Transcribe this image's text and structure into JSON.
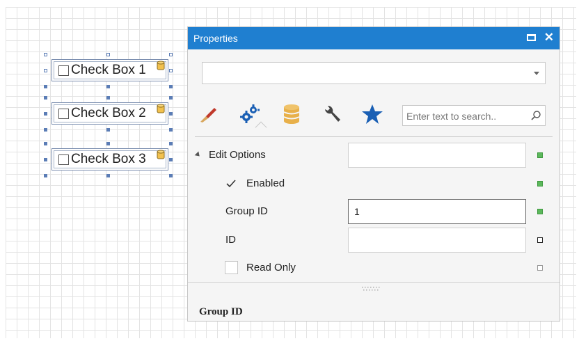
{
  "report_controls": [
    {
      "label": "Check Box 1"
    },
    {
      "label": "Check Box 2"
    },
    {
      "label": "Check Box 3"
    }
  ],
  "properties_panel": {
    "title": "Properties",
    "title_icons": [
      "maximize-icon",
      "close-icon"
    ],
    "combo_value": "",
    "tabs": [
      {
        "name": "appearance-tab",
        "icon": "brush-icon"
      },
      {
        "name": "behavior-tab",
        "icon": "gears-icon",
        "active": true
      },
      {
        "name": "data-tab",
        "icon": "database-icon"
      },
      {
        "name": "layout-tab",
        "icon": "wrench-icon"
      },
      {
        "name": "favorites-tab",
        "icon": "star-icon"
      }
    ],
    "search": {
      "placeholder": "Enter text to search.."
    },
    "rows": {
      "edit_options": {
        "label": "Edit Options",
        "value": "",
        "marker": "green"
      },
      "enabled": {
        "label": "Enabled",
        "checked": true,
        "marker": "green"
      },
      "group_id": {
        "label": "Group ID",
        "value": "1",
        "marker": "green"
      },
      "id": {
        "label": "ID",
        "value": "",
        "marker": "black"
      },
      "read_only": {
        "label": "Read Only",
        "checked": false,
        "marker": "grey"
      }
    },
    "description_title": "Group ID"
  },
  "colors": {
    "title_bar": "#1f7fd0",
    "selection_handles": "#5b7db6",
    "marker_green": "#5cb85c",
    "star": "#1a5fb4",
    "brush": "#d4a35a",
    "database": "#e8b04a"
  }
}
